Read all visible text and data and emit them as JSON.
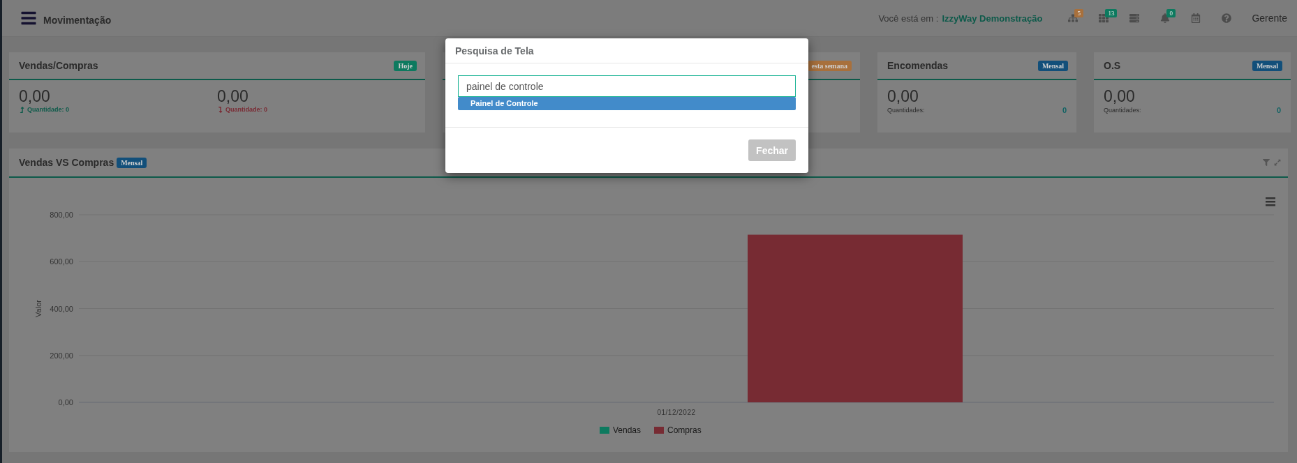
{
  "topbar": {
    "title": "Movimentação",
    "location_label": "Você está em :",
    "location_value": "IzzyWay Demonstração",
    "icons": [
      {
        "kind": "sitemap",
        "badge": "5",
        "color": "#a8703c"
      },
      {
        "kind": "grid",
        "badge": "13",
        "color": "#0d7a5f"
      },
      {
        "kind": "server"
      },
      {
        "kind": "bell",
        "badge": "0",
        "color": "#0d7a5f"
      },
      {
        "kind": "calendar"
      },
      {
        "kind": "help"
      }
    ],
    "user": "Gerente"
  },
  "cards": [
    {
      "kind": "split",
      "title": "Vendas/Compras",
      "badge": {
        "label": "Hoje",
        "color": "#0d7a5f"
      },
      "columns": [
        {
          "value": "0,00",
          "kind": "up",
          "label": "Quantidade: 0"
        },
        {
          "value": "0,00",
          "kind": "down",
          "label": "Quantidade: 0"
        }
      ]
    },
    {
      "kind": "covered",
      "badge": {
        "label": "esta semana",
        "color": "#a8703c"
      }
    },
    {
      "kind": "summary",
      "title": "Encomendas",
      "badge": {
        "label": "Mensal",
        "color": "#124f7a"
      },
      "value": "0,00",
      "label": "Quantidades:",
      "count": "0"
    },
    {
      "kind": "summary",
      "title": "O.S",
      "badge": {
        "label": "Mensal",
        "color": "#124f7a"
      },
      "value": "0,00",
      "label": "Quantidades:",
      "count": "0"
    }
  ],
  "chart_panel": {
    "title": "Vendas VS Compras",
    "badge": {
      "label": "Mensal",
      "color": "#124f7a"
    },
    "chart_data": {
      "type": "bar",
      "grid": true,
      "ylabel": "Valor",
      "categories": [
        "01/12/2022"
      ],
      "ylim": [
        0,
        800
      ],
      "yticks": [
        {
          "value": 0,
          "label": "0,00"
        },
        {
          "value": 200,
          "label": "200,00"
        },
        {
          "value": 400,
          "label": "400,00"
        },
        {
          "value": 600,
          "label": "600,00"
        },
        {
          "value": 800,
          "label": "800,00"
        }
      ],
      "series": [
        {
          "name": "Vendas",
          "color": "#0d7a5f",
          "values": [
            0
          ]
        },
        {
          "name": "Compras",
          "color": "#772b33",
          "values": [
            715
          ]
        }
      ]
    }
  },
  "modal": {
    "title": "Pesquisa de Tela",
    "search": {
      "value": "painel de controle"
    },
    "suggestions": [
      {
        "label": "Painel de Controle",
        "selected": true
      }
    ],
    "buttons": [
      {
        "label": "Fechar",
        "disabled": true
      }
    ]
  }
}
